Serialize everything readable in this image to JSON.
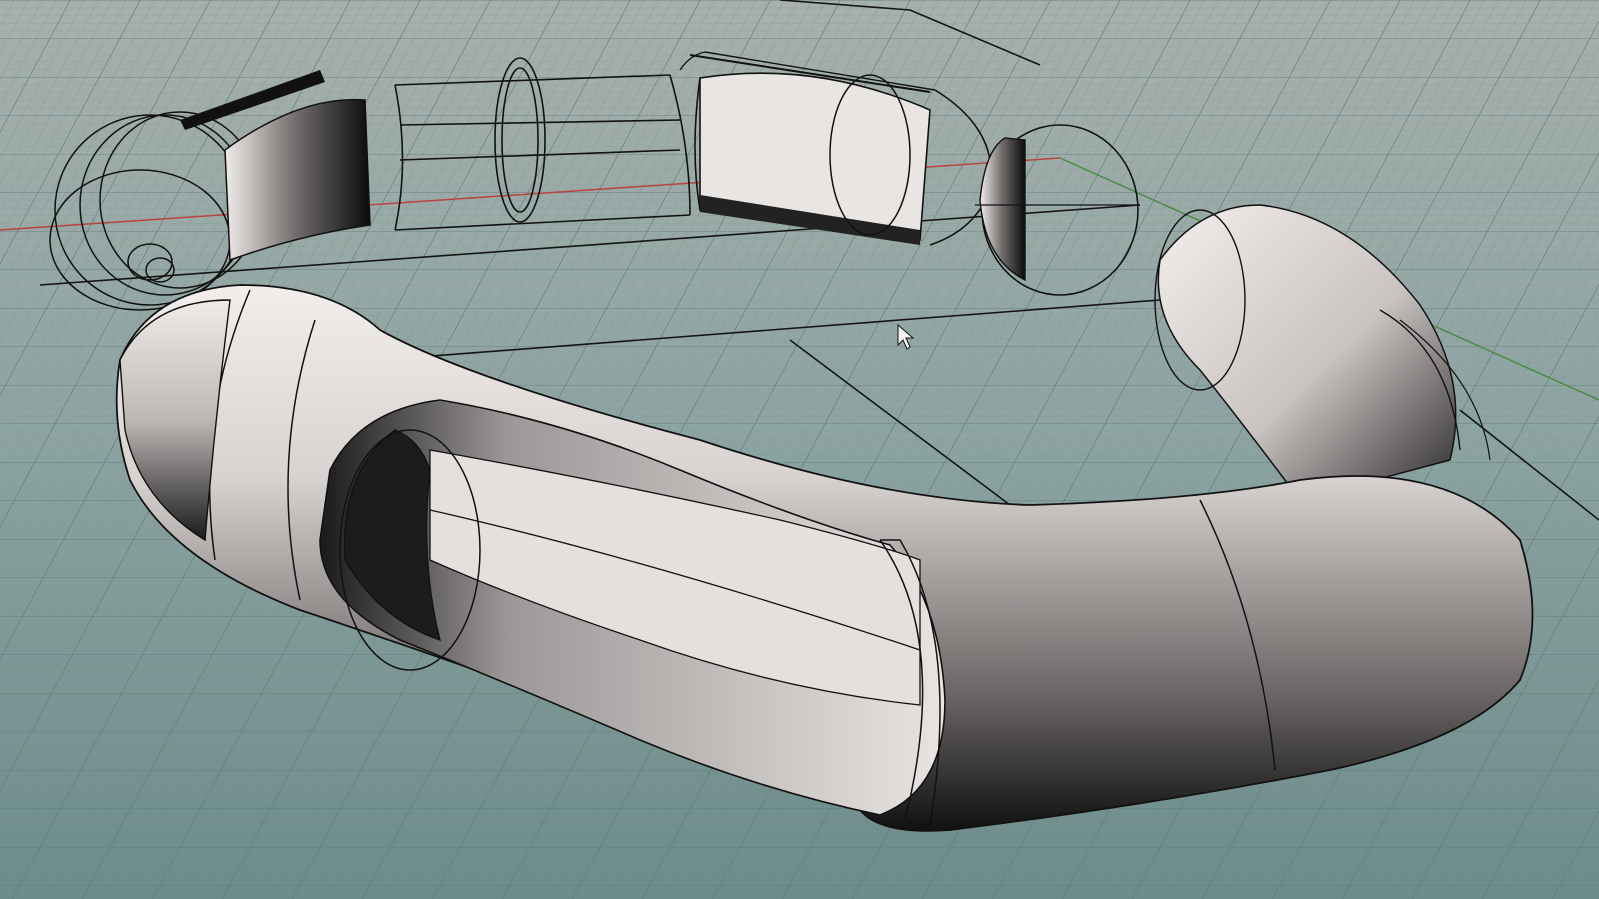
{
  "viewport": {
    "projection": "perspective",
    "display_mode": "shaded",
    "grid": true,
    "axes_visible": [
      "x-axis",
      "y-axis"
    ],
    "colors": {
      "background_top": "#a3aeab",
      "background_bottom": "#6f8e8c",
      "grid_minor": "#7f9795",
      "grid_major": "#5f7a78",
      "x_axis": "#b8443c",
      "y_axis": "#4a8a4a",
      "wire": "#1a1a1a",
      "surface_light": "#e6e2e0",
      "surface_dark": "#141414"
    },
    "icons": [
      "mouse-cursor-icon"
    ]
  },
  "scene": {
    "objects": [
      "exhaust-pipe-assembly",
      "exploded-pipe-components"
    ]
  }
}
